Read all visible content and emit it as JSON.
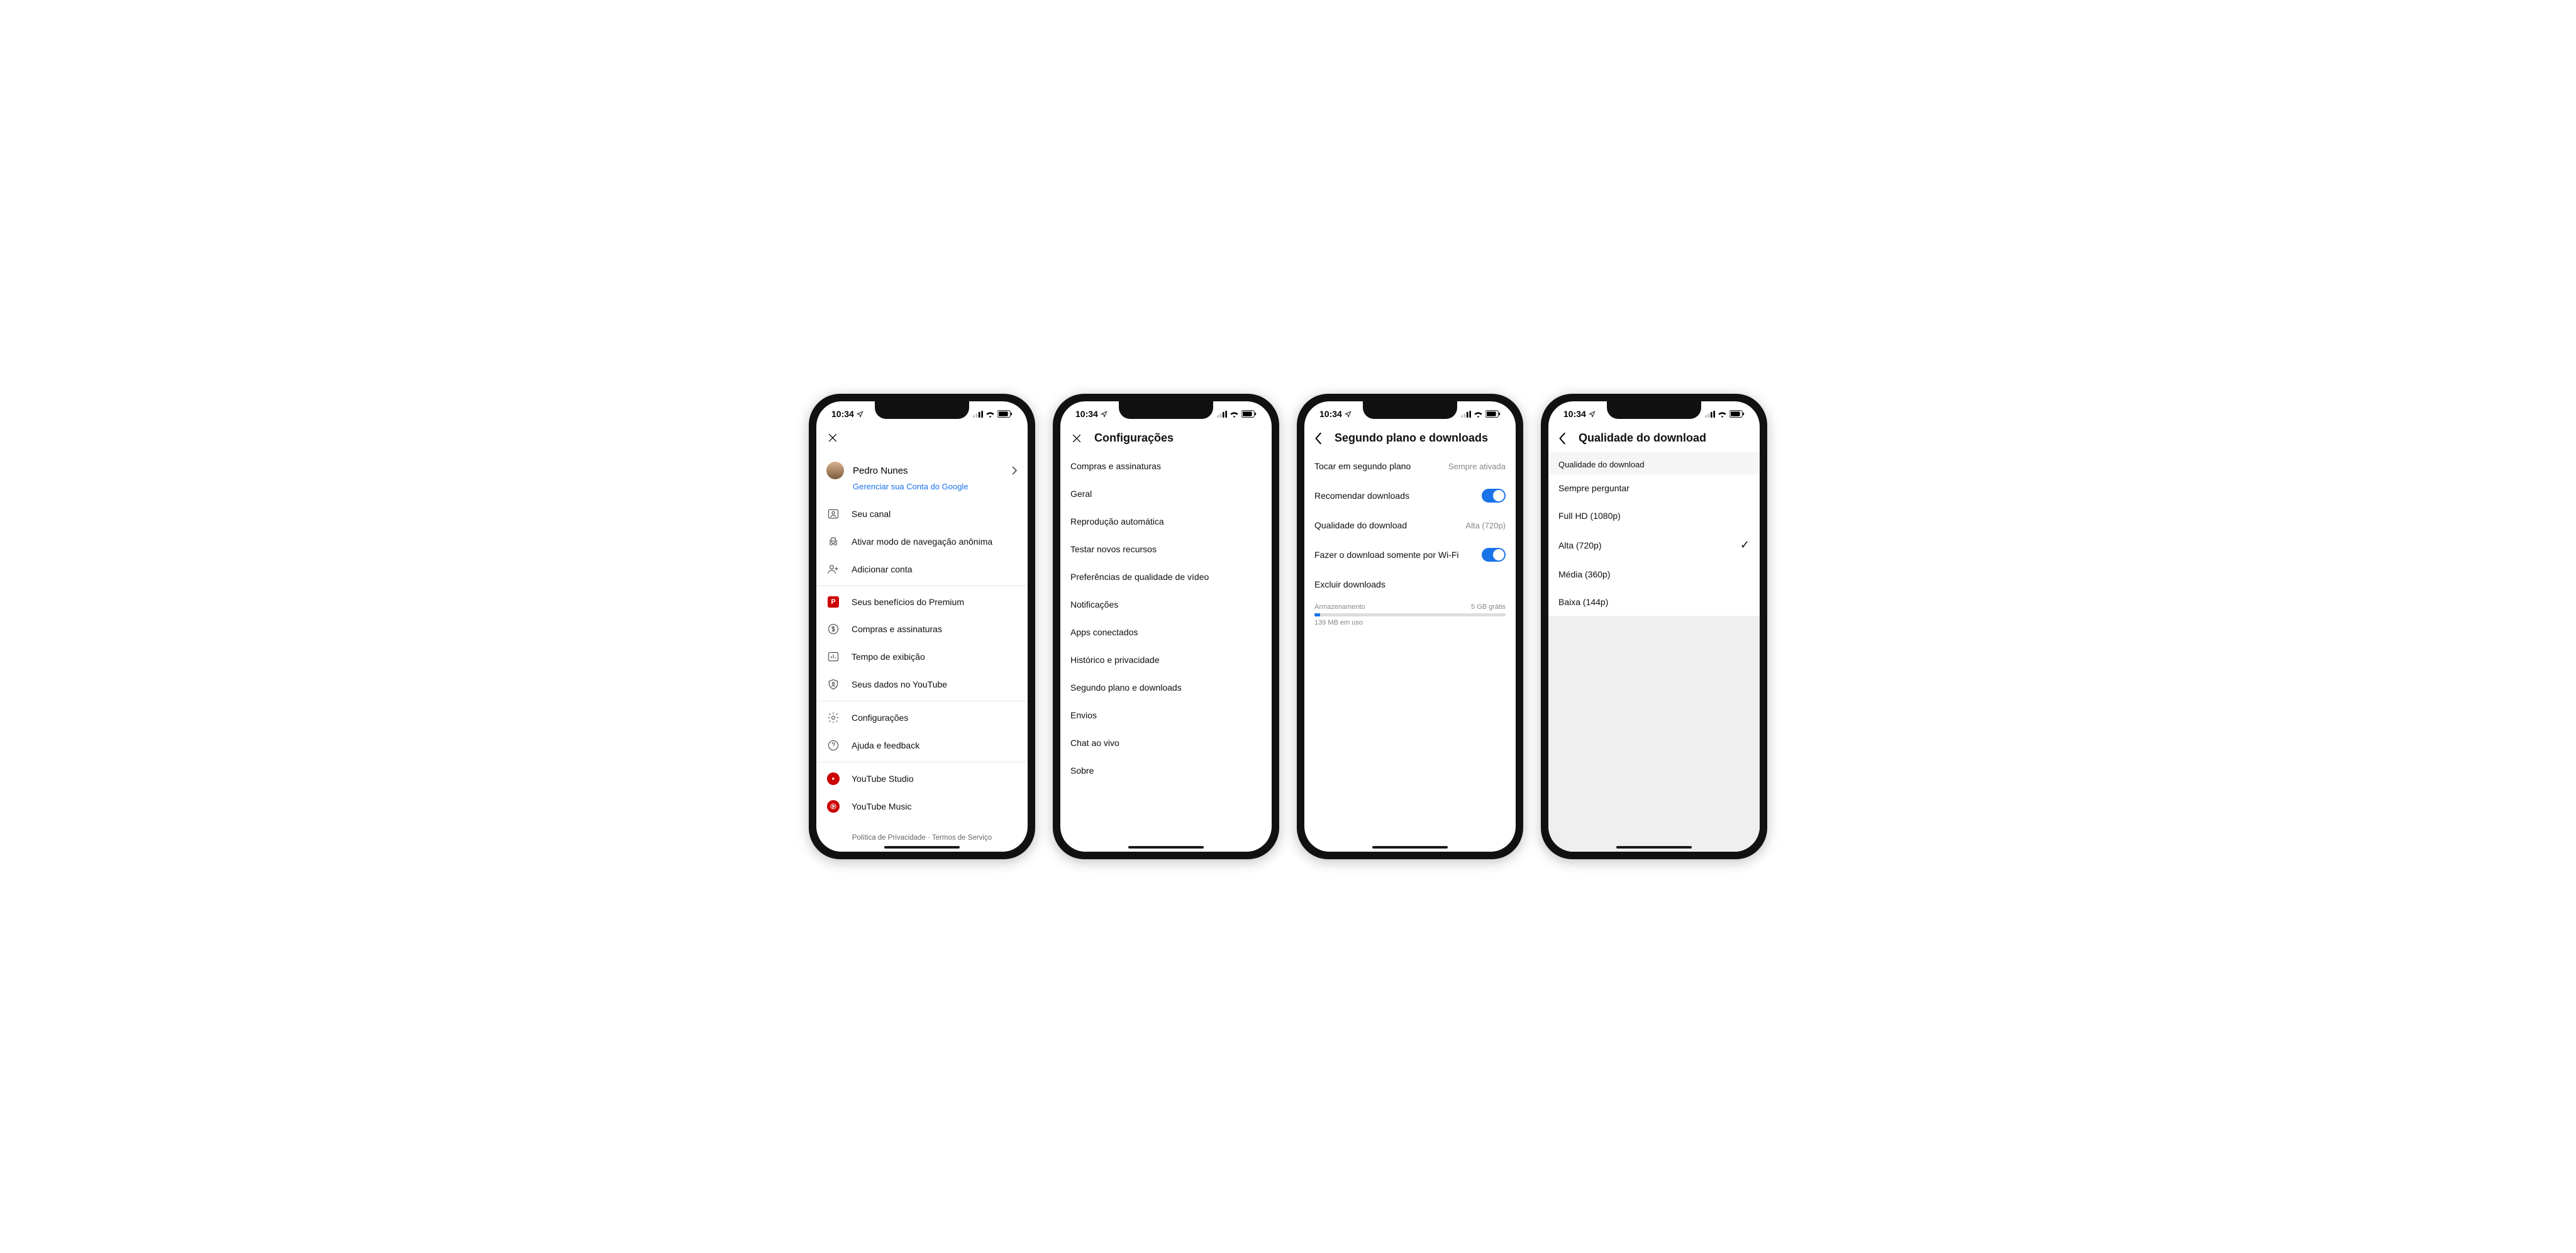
{
  "status": {
    "time": "10:34"
  },
  "phone1": {
    "user_name": "Pedro Nunes",
    "manage_link": "Gerenciar sua Conta do Google",
    "items1": [
      {
        "label": "Seu canal"
      },
      {
        "label": "Ativar modo de navegação anônima"
      },
      {
        "label": "Adicionar conta"
      }
    ],
    "items2": [
      {
        "label": "Seus benefícios do Premium"
      },
      {
        "label": "Compras e assinaturas"
      },
      {
        "label": "Tempo de exibição"
      },
      {
        "label": "Seus dados no YouTube"
      }
    ],
    "items3": [
      {
        "label": "Configurações"
      },
      {
        "label": "Ajuda e feedback"
      }
    ],
    "items4": [
      {
        "label": "YouTube Studio"
      },
      {
        "label": "YouTube Music"
      }
    ],
    "footer": {
      "privacy": "Política de Privacidade",
      "terms": "Termos de Serviço",
      "sep": " · "
    }
  },
  "phone2": {
    "title": "Configurações",
    "items": [
      "Compras e assinaturas",
      "Geral",
      "Reprodução automática",
      "Testar novos recursos",
      "Preferências de qualidade de vídeo",
      "Notificações",
      "Apps conectados",
      "Histórico e privacidade",
      "Segundo plano e downloads",
      "Envios",
      "Chat ao vivo",
      "Sobre"
    ]
  },
  "phone3": {
    "title": "Segundo plano e downloads",
    "rows": {
      "background": {
        "label": "Tocar em segundo plano",
        "value": "Sempre ativada"
      },
      "recommend": {
        "label": "Recomendar downloads"
      },
      "quality": {
        "label": "Qualidade do download",
        "value": "Alta (720p)"
      },
      "wifi": {
        "label": "Fazer o download somente por Wi-Fi"
      },
      "delete": {
        "label": "Excluir downloads"
      }
    },
    "storage": {
      "label": "Armazenamento",
      "free": "5 GB grátis",
      "used": "139 MB em uso"
    }
  },
  "phone4": {
    "title": "Qualidade do download",
    "section_header": "Qualidade do download",
    "options": [
      {
        "label": "Sempre perguntar",
        "selected": false
      },
      {
        "label": "Full HD (1080p)",
        "selected": false
      },
      {
        "label": "Alta (720p)",
        "selected": true
      },
      {
        "label": "Média (360p)",
        "selected": false
      },
      {
        "label": "Baixa (144p)",
        "selected": false
      }
    ]
  }
}
